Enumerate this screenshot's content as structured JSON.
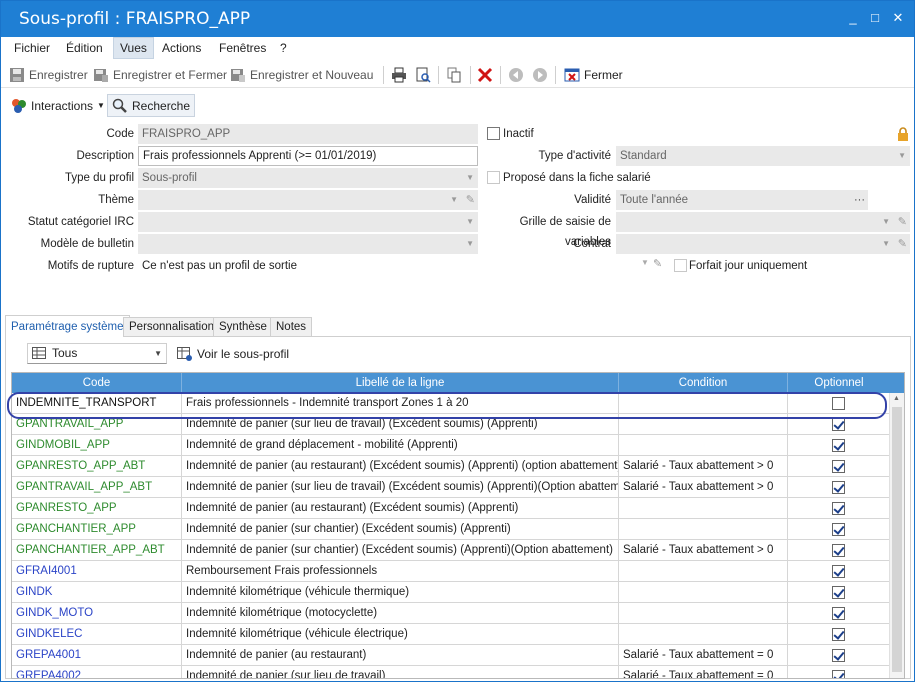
{
  "window": {
    "title": "Sous-profil : FRAISPRO_APP",
    "minimize": "_",
    "maximize": "□",
    "close": "✕"
  },
  "menu": [
    "Fichier",
    "Édition",
    "Vues",
    "Actions",
    "Fenêtres",
    "?"
  ],
  "toolbar": {
    "save": "Enregistrer",
    "save_close": "Enregistrer et Fermer",
    "save_new": "Enregistrer et Nouveau",
    "close": "Fermer"
  },
  "toolbar2": {
    "interactions": "Interactions",
    "search": "Recherche"
  },
  "form": {
    "code_label": "Code",
    "code_value": "FRAISPRO_APP",
    "inactif_label": "Inactif",
    "description_label": "Description",
    "description_value": "Frais professionnels Apprenti (>= 01/01/2019)",
    "type_activite_label": "Type d'activité",
    "type_activite_value": "Standard",
    "type_profil_label": "Type du profil",
    "type_profil_value": "Sous-profil",
    "propose_label": "Proposé dans la fiche salarié",
    "theme_label": "Thème",
    "validite_label": "Validité",
    "validite_value": "Toute l'année",
    "validite_btn": "···",
    "statut_label": "Statut catégoriel IRC",
    "grille_label": "Grille de saisie de variables",
    "modele_label": "Modèle de bulletin",
    "contrat_label": "Contrat",
    "motifs_label": "Motifs de rupture",
    "motifs_value": "Ce n'est pas un profil de sortie",
    "forfait_label": "Forfait jour uniquement"
  },
  "tabs": [
    "Paramétrage système",
    "Personnalisation",
    "Synthèse",
    "Notes"
  ],
  "filter": {
    "combo_value": "Tous",
    "voir": "Voir le sous-profil"
  },
  "grid": {
    "headers": [
      "Code",
      "Libellé de la ligne",
      "Condition",
      "Optionnel"
    ],
    "rows": [
      {
        "code": "INDEMNITE_TRANSPORT",
        "color": "black",
        "libelle": "Frais professionnels - Indemnité transport Zones 1 à 20",
        "condition": "",
        "optionnel": false
      },
      {
        "code": "GPANTRAVAIL_APP",
        "color": "green",
        "libelle": "Indemnité de panier (sur lieu de travail) (Excédent soumis) (Apprenti)",
        "condition": "",
        "optionnel": true
      },
      {
        "code": "GINDMOBIL_APP",
        "color": "green",
        "libelle": "Indemnité de grand déplacement - mobilité (Apprenti)",
        "condition": "",
        "optionnel": true
      },
      {
        "code": "GPANRESTO_APP_ABT",
        "color": "green",
        "libelle": "Indemnité de panier (au restaurant) (Excédent soumis) (Apprenti) (option abattement)",
        "condition": "Salarié - Taux abattement > 0",
        "optionnel": true
      },
      {
        "code": "GPANTRAVAIL_APP_ABT",
        "color": "green",
        "libelle": "Indemnité de panier (sur lieu de travail) (Excédent soumis) (Apprenti)(Option abattement)",
        "condition": "Salarié - Taux abattement > 0",
        "optionnel": true
      },
      {
        "code": "GPANRESTO_APP",
        "color": "green",
        "libelle": "Indemnité de panier (au restaurant) (Excédent soumis) (Apprenti)",
        "condition": "",
        "optionnel": true
      },
      {
        "code": "GPANCHANTIER_APP",
        "color": "green",
        "libelle": "Indemnité de panier (sur chantier) (Excédent soumis) (Apprenti)",
        "condition": "",
        "optionnel": true
      },
      {
        "code": "GPANCHANTIER_APP_ABT",
        "color": "green",
        "libelle": "Indemnité de panier (sur chantier) (Excédent soumis) (Apprenti)(Option abattement)",
        "condition": "Salarié - Taux abattement > 0",
        "optionnel": true
      },
      {
        "code": "GFRAI4001",
        "color": "blue",
        "libelle": "Remboursement Frais professionnels",
        "condition": "",
        "optionnel": true
      },
      {
        "code": "GINDK",
        "color": "blue",
        "libelle": "Indemnité kilométrique (véhicule thermique)",
        "condition": "",
        "optionnel": true
      },
      {
        "code": "GINDK_MOTO",
        "color": "blue",
        "libelle": "Indemnité kilométrique (motocyclette)",
        "condition": "",
        "optionnel": true
      },
      {
        "code": "GINDKELEC",
        "color": "blue",
        "libelle": "Indemnité kilométrique (véhicule électrique)",
        "condition": "",
        "optionnel": true
      },
      {
        "code": "GREPA4001",
        "color": "blue",
        "libelle": "Indemnité de panier (au restaurant)",
        "condition": "Salarié - Taux abattement = 0",
        "optionnel": true
      },
      {
        "code": "GREPA4002",
        "color": "blue",
        "libelle": "Indemnité de panier (sur lieu de travail)",
        "condition": "Salarié - Taux abattement = 0",
        "optionnel": true
      }
    ]
  }
}
